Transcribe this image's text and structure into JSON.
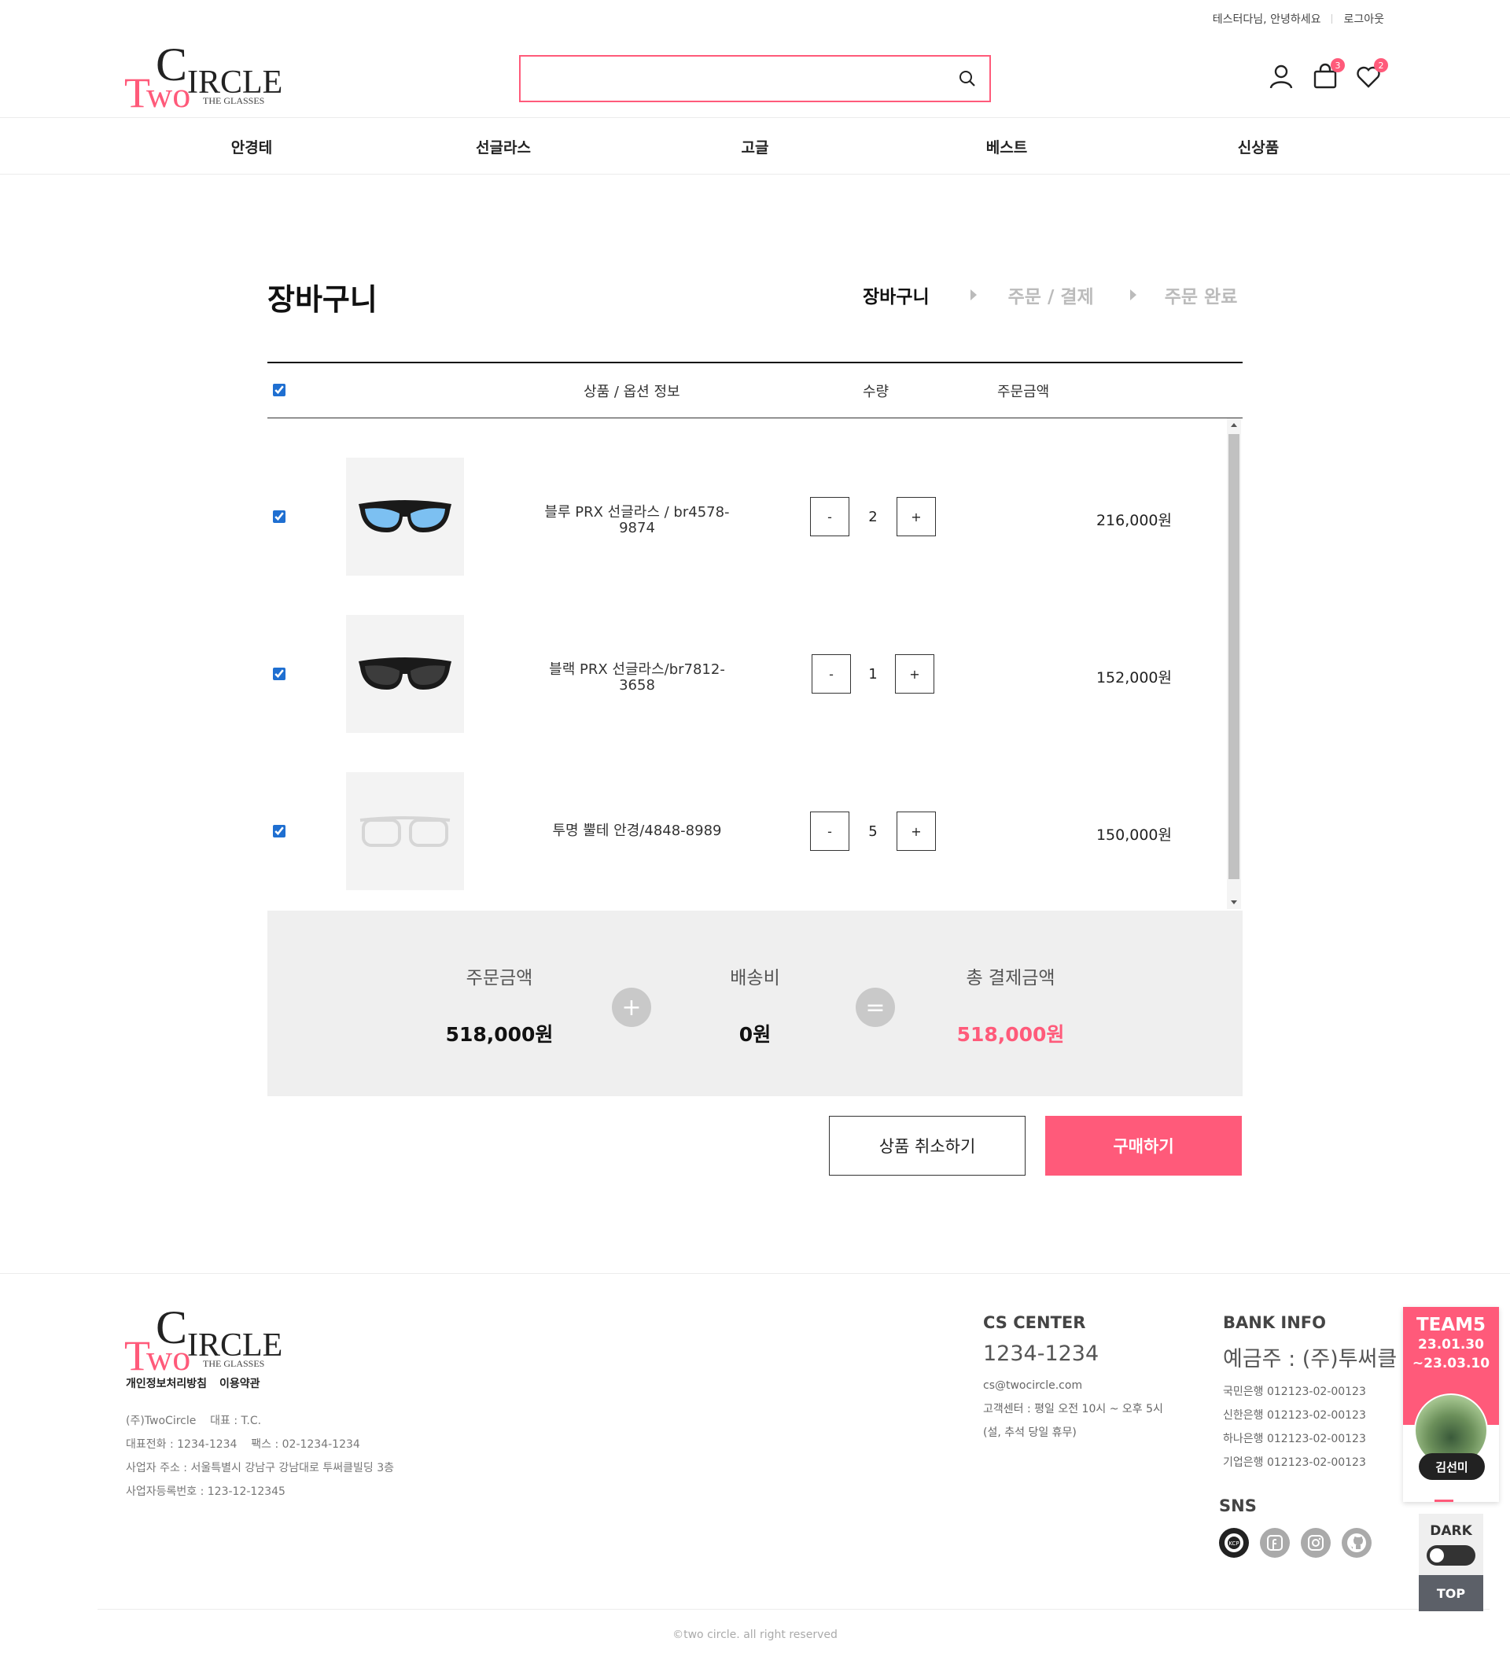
{
  "header": {
    "greeting": "테스터다님, 안녕하세요",
    "logout": "로그아웃",
    "logo": {
      "big": "TwoCIRCLE",
      "sub": "THE GLASSES"
    },
    "search_placeholder": "",
    "cart_count": "3",
    "wish_count": "2"
  },
  "nav": [
    "안경테",
    "선글라스",
    "고글",
    "베스트",
    "신상품"
  ],
  "cart": {
    "title": "장바구니",
    "steps": [
      "장바구니",
      "주문 / 결제",
      "주문 완료"
    ],
    "columns": {
      "product": "상품 / 옵션 정보",
      "qty": "수량",
      "amount": "주문금액"
    },
    "items": [
      {
        "name": "블루 PRX 선글라스 / br4578-9874",
        "qty": "2",
        "price": "216,000원",
        "image": "blue-sunglasses",
        "checked": true
      },
      {
        "name": "블랙 PRX 선글라스/br7812-3658",
        "qty": "1",
        "price": "152,000원",
        "image": "black-sunglasses",
        "checked": true
      },
      {
        "name": "투명 뿔테 안경/4848-8989",
        "qty": "5",
        "price": "150,000원",
        "image": "clear-glasses",
        "checked": true
      }
    ],
    "minus": "-",
    "plus": "+",
    "summary": {
      "order_label": "주문금액",
      "order_value": "518,000원",
      "ship_label": "배송비",
      "ship_value": "0원",
      "total_label": "총 결제금액",
      "total_value": "518,000원",
      "plus_op": "+",
      "eq_op": "="
    },
    "cancel_button": "상품 취소하기",
    "buy_button": "구매하기"
  },
  "footer": {
    "links": [
      "개인정보처리방침",
      "이용약관"
    ],
    "company": [
      "(주)TwoCircle    대표 : T.C.",
      "대표전화 : 1234-1234    팩스 : 02-1234-1234",
      "사업자 주소 : 서울특별시 강남구 강남대로 투써클빌딩 3층",
      "사업자등록번호 : 123-12-12345"
    ],
    "cs": {
      "title": "CS CENTER",
      "phone": "1234-1234",
      "lines": [
        "cs@twocircle.com",
        "고객센터 : 평일 오전 10시 ~ 오후 5시",
        "(설, 추석 당일 휴무)"
      ]
    },
    "bank": {
      "title": "BANK INFO",
      "holder": "예금주 : (주)투써클",
      "lines": [
        "국민은행 012123-02-00123",
        "신한은행 012123-02-00123",
        "하나은행 012123-02-00123",
        "기업은행 012123-02-00123"
      ]
    },
    "sns_title": "SNS",
    "sns": [
      "kcp-icon",
      "facebook-icon",
      "instagram-icon",
      "github-icon"
    ],
    "copyright": "©two circle. all right reserved"
  },
  "widget": {
    "team": "TEAM5",
    "date1": "23.01.30",
    "date2": "~23.03.10",
    "member": "김선미",
    "dark_label": "DARK",
    "top_label": "TOP"
  },
  "colors": {
    "accent": "#ff5a7a",
    "summary_bg": "#efefef",
    "text": "#222222"
  }
}
